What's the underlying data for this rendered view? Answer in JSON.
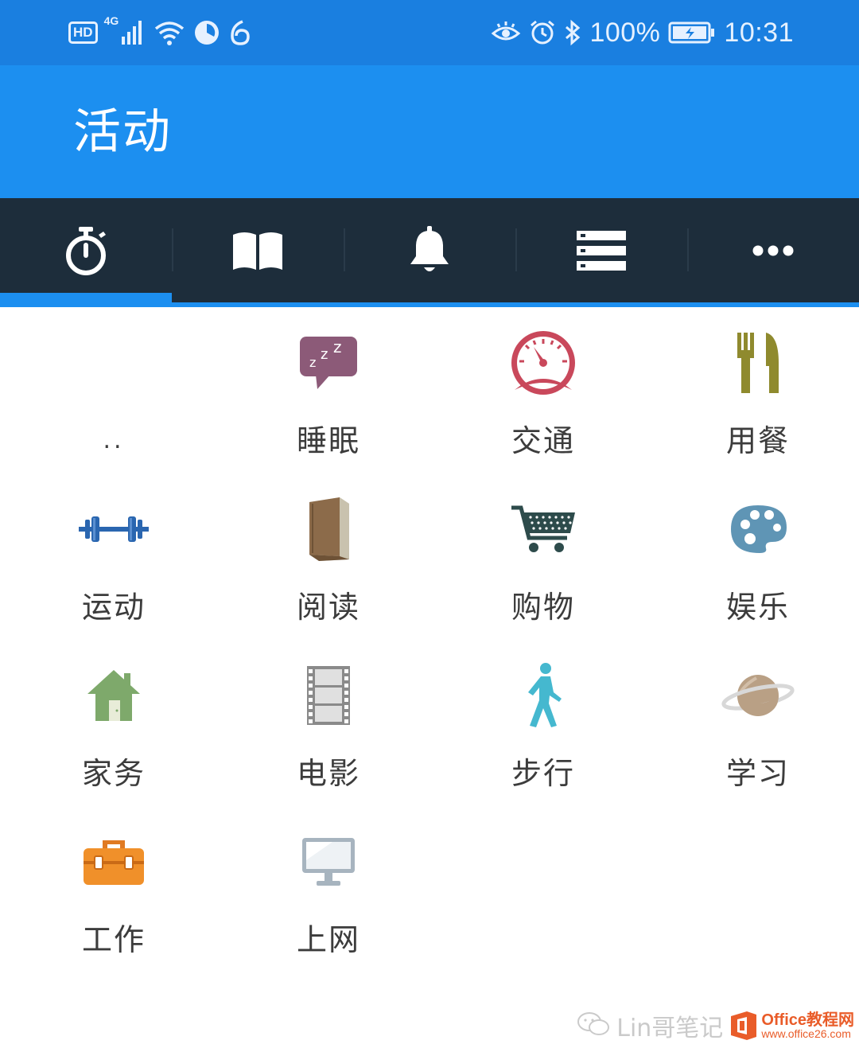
{
  "status_bar": {
    "hd_label": "HD",
    "network_label": "4G",
    "battery_percent": "100%",
    "time": "10:31",
    "left_icons": [
      "hd-badge",
      "signal-icon",
      "wifi-icon",
      "timer-app-icon",
      "netease-icon"
    ],
    "right_icons": [
      "eye-comfort-icon",
      "alarm-icon",
      "bluetooth-icon",
      "battery-icon"
    ]
  },
  "app_bar": {
    "title": "活动",
    "background": "#1c8ff0"
  },
  "tabs": [
    {
      "name": "stopwatch",
      "icon": "stopwatch-icon",
      "active": true
    },
    {
      "name": "book",
      "icon": "book-icon",
      "active": false
    },
    {
      "name": "bell",
      "icon": "bell-icon",
      "active": false
    },
    {
      "name": "list",
      "icon": "list-icon",
      "active": false
    },
    {
      "name": "more",
      "icon": "more-icon",
      "active": false
    }
  ],
  "activities": [
    {
      "label": "..",
      "icon": "parent-folder"
    },
    {
      "label": "睡眠",
      "icon": "sleep-icon"
    },
    {
      "label": "交通",
      "icon": "speedometer-icon"
    },
    {
      "label": "用餐",
      "icon": "fork-knife-icon"
    },
    {
      "label": "运动",
      "icon": "dumbbell-icon"
    },
    {
      "label": "阅读",
      "icon": "book-icon"
    },
    {
      "label": "购物",
      "icon": "cart-icon"
    },
    {
      "label": "娱乐",
      "icon": "palette-icon"
    },
    {
      "label": "家务",
      "icon": "house-icon"
    },
    {
      "label": "电影",
      "icon": "film-icon"
    },
    {
      "label": "步行",
      "icon": "walker-icon"
    },
    {
      "label": "学习",
      "icon": "planet-icon"
    },
    {
      "label": "工作",
      "icon": "toolbox-icon"
    },
    {
      "label": "上网",
      "icon": "monitor-icon"
    }
  ],
  "watermark": {
    "wechat_text": "Lin哥笔记",
    "brand_top": "Office教程网",
    "brand_bottom": "www.office26.com"
  },
  "colors": {
    "status_bar": "#1a7fe0",
    "tab_bar": "#1d2d3b",
    "accent": "#1c8ff0",
    "label_text": "#3c3c3c"
  }
}
